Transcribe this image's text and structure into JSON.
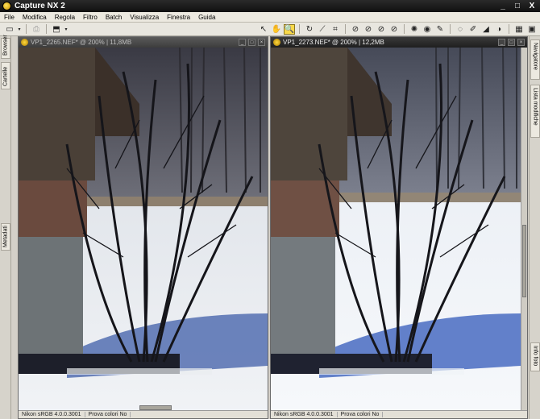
{
  "app": {
    "title": "Capture NX 2"
  },
  "window_controls": {
    "minimize": "_",
    "maximize": "□",
    "close": "X"
  },
  "menu": [
    "File",
    "Modifica",
    "Regola",
    "Filtro",
    "Batch",
    "Visualizza",
    "Finestra",
    "Guida"
  ],
  "toolbar": {
    "left_icons": [
      "browser-icon",
      "printer-icon",
      "export-icon"
    ],
    "right_icons": [
      "arrow-icon",
      "hand-icon",
      "zoom-icon",
      "rotate-icon",
      "straighten-icon",
      "crop-icon",
      "cp-black-icon",
      "cp-neutral-icon",
      "cp-white-icon",
      "cp-color-icon",
      "redeye-icon",
      "eye-icon",
      "auto-retouch-icon",
      "lasso-icon",
      "brush-icon",
      "gradient-icon",
      "fill-icon",
      "layout-icon",
      "fullscreen-icon"
    ]
  },
  "left_dock": {
    "tabs": [
      "Browser",
      "Cartelle",
      "Metadati"
    ]
  },
  "right_dock": {
    "tabs": [
      "Navigatore",
      "Lista modifiche",
      "Info foto"
    ]
  },
  "windows": [
    {
      "title": "VP1_2265.NEF* @ 200% | 11,8MB",
      "active": false,
      "status": {
        "profile": "Nikon sRGB 4.0.0.3001",
        "softproof": "Prova colori No"
      }
    },
    {
      "title": "VP1_2273.NEF* @ 200% | 12,2MB",
      "active": true,
      "status": {
        "profile": "Nikon sRGB 4.0.0.3001",
        "softproof": "Prova colori No"
      }
    }
  ]
}
